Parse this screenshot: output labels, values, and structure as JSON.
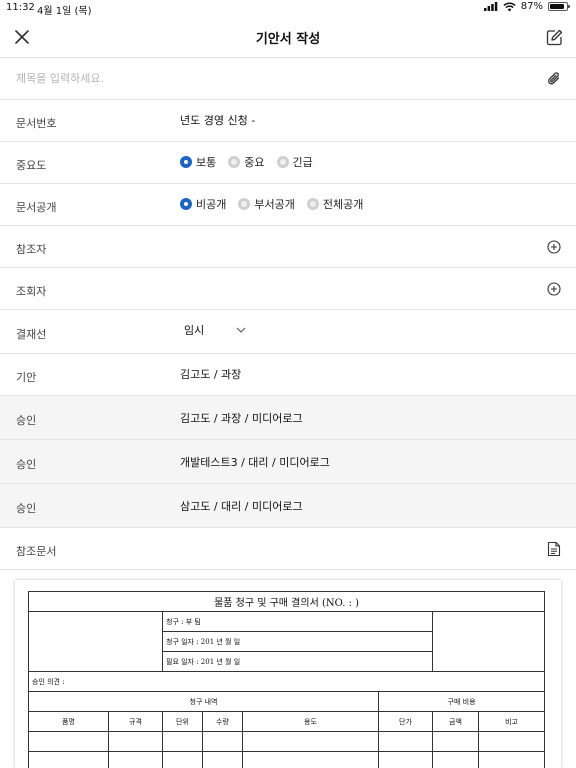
{
  "status": {
    "time": "11:32",
    "date": "4월 1일 (목)",
    "battery": "87%",
    "battery_level": 0.87
  },
  "nav": {
    "title": "기안서 작성",
    "close_icon": "close-icon",
    "edit_icon": "compose-icon"
  },
  "subject": {
    "placeholder": "제목을 입력하세요.",
    "attach_icon": "paperclip-icon"
  },
  "doc_number": {
    "label": "문서번호",
    "value": "년도 경영 신청 -"
  },
  "importance": {
    "label": "중요도",
    "options": [
      "보통",
      "중요",
      "긴급"
    ],
    "selected": "보통"
  },
  "disclosure": {
    "label": "문서공개",
    "options": [
      "비공개",
      "부서공개",
      "전체공개"
    ],
    "selected": "비공개"
  },
  "reference": {
    "label": "참조자"
  },
  "viewer": {
    "label": "조회자"
  },
  "approval_line": {
    "label": "결재선",
    "value": "임시"
  },
  "drafter": {
    "label": "기안",
    "value": "김고도 / 과장"
  },
  "approvers": [
    {
      "label": "승인",
      "value": "김고도 / 과장 / 미디어로그"
    },
    {
      "label": "승인",
      "value": "개발테스트3 / 대리 / 미디어로그"
    },
    {
      "label": "승인",
      "value": "삼고도 / 대리 / 미디어로그"
    }
  ],
  "ref_doc": {
    "label": "참조문서"
  },
  "form": {
    "title": "물품 청구 및 구매 결의서 (NO. :              )",
    "requester": "청구 :          부          팀",
    "request_date": "청구 일자 : 201    년    월    일",
    "need_date": "필요 일자 : 201    년    월    일",
    "opinion": "승인 의견 :",
    "section_request": "청구 내역",
    "section_cost": "구매 비용",
    "columns": [
      "품명",
      "규격",
      "단위",
      "수량",
      "용도",
      "단가",
      "금액",
      "비고"
    ]
  }
}
